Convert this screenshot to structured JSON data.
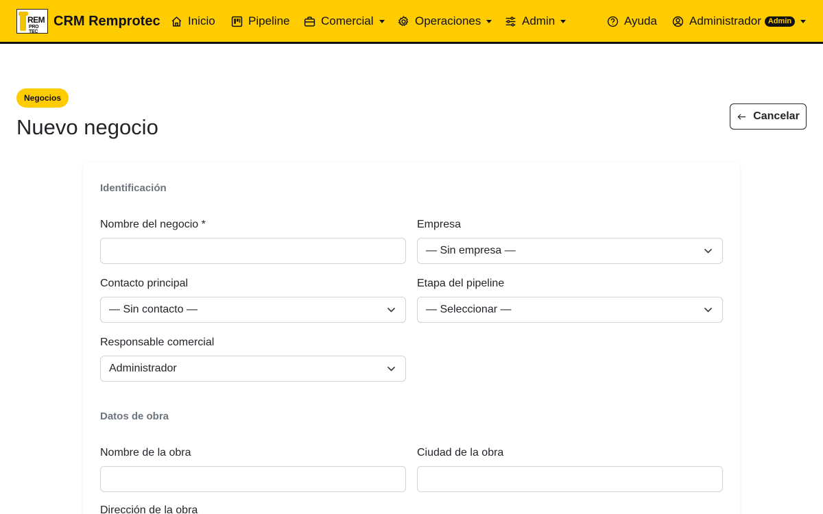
{
  "navbar": {
    "logo_text_top": "REM",
    "logo_text_bottom": "PRO TEC",
    "brand": "CRM Remprotec",
    "items": [
      {
        "label": "Inicio",
        "icon": "home-icon"
      },
      {
        "label": "Pipeline",
        "icon": "kanban-icon"
      },
      {
        "label": "Comercial",
        "icon": "briefcase-icon"
      },
      {
        "label": "Operaciones",
        "icon": "gear-icon"
      },
      {
        "label": "Admin",
        "icon": "sliders-icon"
      }
    ],
    "help_label": "Ayuda",
    "user_label": "Administrador",
    "user_badge": "Admin"
  },
  "header": {
    "section_badge": "Negocios",
    "title": "Nuevo negocio",
    "cancel_label": "Cancelar"
  },
  "form": {
    "identificacion": {
      "title": "Identificación",
      "nombre_negocio": {
        "label": "Nombre del negocio *",
        "value": ""
      },
      "empresa": {
        "label": "Empresa",
        "selected": "— Sin empresa —"
      },
      "contacto": {
        "label": "Contacto principal",
        "selected": "— Sin contacto —"
      },
      "etapa": {
        "label": "Etapa del pipeline",
        "selected": "— Seleccionar —"
      },
      "responsable": {
        "label": "Responsable comercial",
        "selected": "Administrador"
      }
    },
    "obra": {
      "title": "Datos de obra",
      "nombre_obra": {
        "label": "Nombre de la obra",
        "value": ""
      },
      "ciudad_obra": {
        "label": "Ciudad de la obra",
        "value": ""
      },
      "direccion_obra": {
        "label": "Dirección de la obra"
      }
    }
  },
  "colors": {
    "accent": "#ffcc00",
    "dark": "#111111",
    "muted": "#6c757d",
    "border": "#ced4da"
  }
}
